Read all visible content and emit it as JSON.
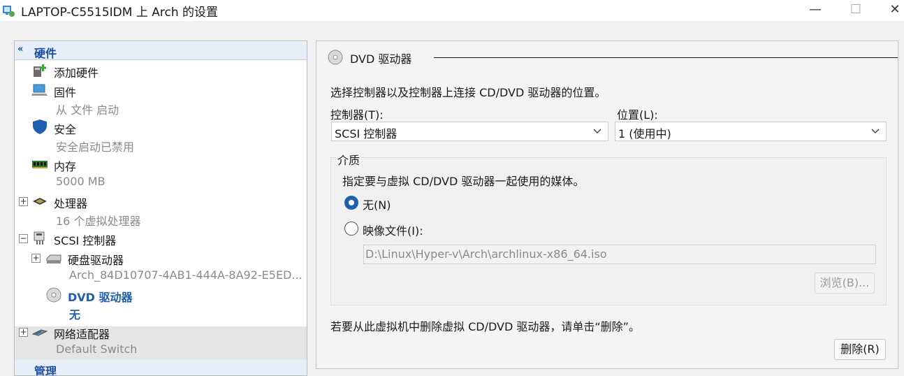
{
  "window": {
    "title": "LAPTOP-C5515IDM 上 Arch 的设置",
    "minimize": "—",
    "maximize": "☐",
    "close": "✕"
  },
  "tree": {
    "section_label": "硬件",
    "items": {
      "add_hardware": {
        "label": "添加硬件"
      },
      "firmware": {
        "label": "固件",
        "sub": "从 文件 启动"
      },
      "security": {
        "label": "安全",
        "sub": "安全启动已禁用"
      },
      "memory": {
        "label": "内存",
        "sub": "5000 MB"
      },
      "processor": {
        "label": "处理器",
        "sub": "16 个虚拟处理器"
      },
      "scsi": {
        "label": "SCSI 控制器"
      },
      "hard_drive": {
        "label": "硬盘驱动器",
        "sub": "Arch_84D10707-4AB1-444A-8A92-E5ED..."
      },
      "dvd": {
        "label": "DVD 驱动器",
        "sub": "无"
      },
      "network": {
        "label": "网络适配器",
        "sub": "Default Switch"
      },
      "management": {
        "label": "管理"
      }
    }
  },
  "detail": {
    "section_title": "DVD 驱动器",
    "description": "选择控制器以及控制器上连接 CD/DVD 驱动器的位置。",
    "controller_label": "控制器(T):",
    "controller_value": "SCSI 控制器",
    "location_label": "位置(L):",
    "location_value": "1 (使用中)",
    "media": {
      "group_label": "介质",
      "description": "指定要与虚拟 CD/DVD 驱动器一起使用的媒体。",
      "none_label": "无(N)",
      "image_label": "映像文件(I):",
      "image_path": "D:\\Linux\\Hyper-v\\Arch\\archlinux-x86_64.iso",
      "browse_label": "浏览(B)...",
      "selected": "none"
    },
    "remove_hint": "若要从此虚拟机中删除虚拟 CD/DVD 驱动器，请单击“删除”。",
    "remove_button": "删除(R)"
  },
  "colors": {
    "accent": "#1f5fae",
    "selected_row": "#e5e5e5",
    "secondary_text": "#8a8a8a"
  }
}
